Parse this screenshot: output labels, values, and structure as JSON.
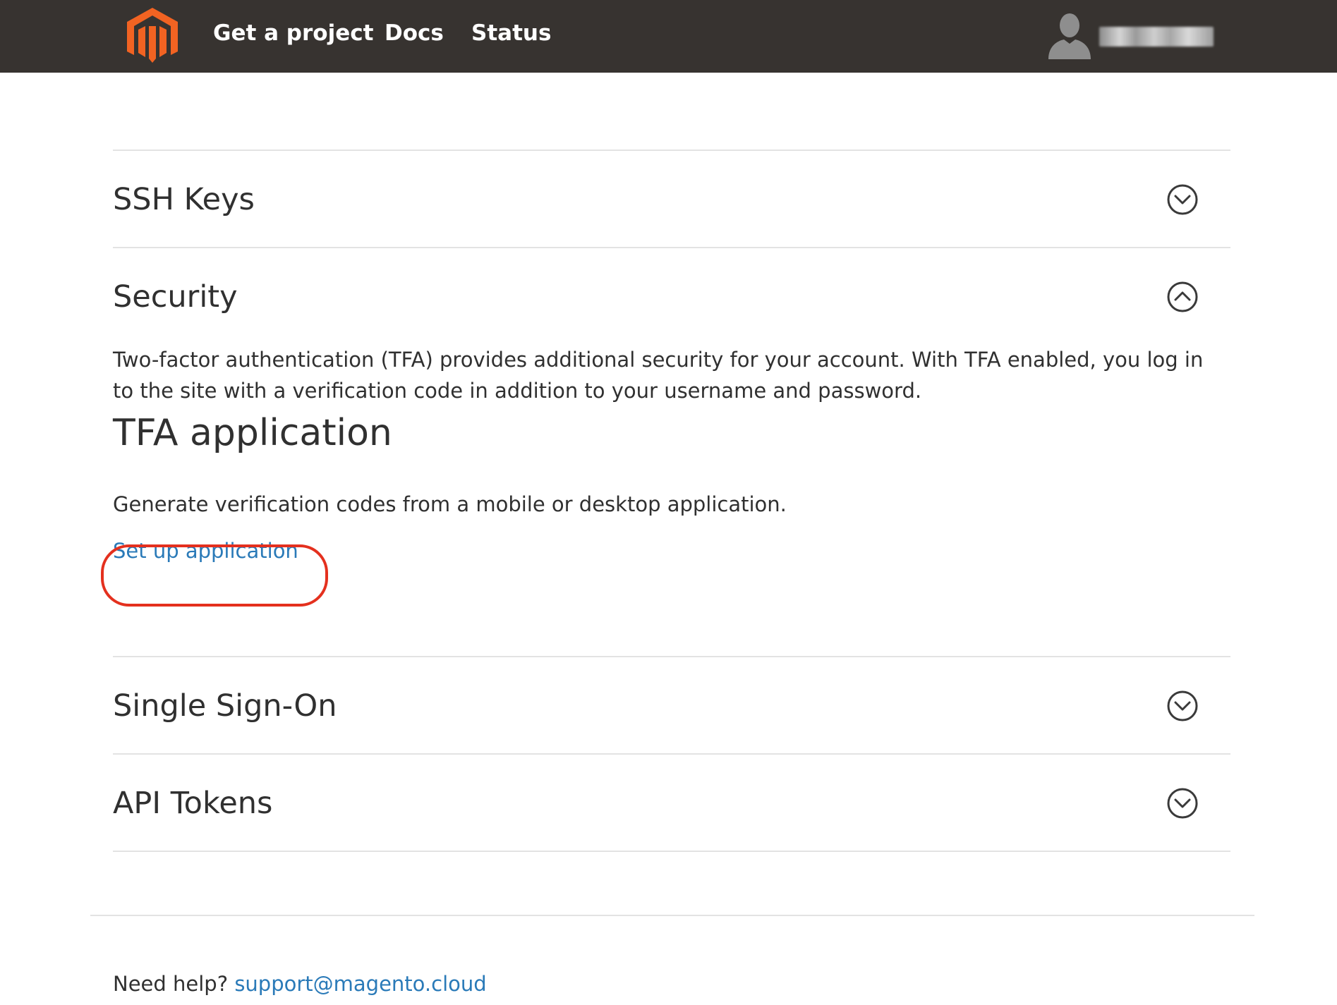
{
  "nav": {
    "items": [
      {
        "label": "Get a project"
      },
      {
        "label": "Docs"
      },
      {
        "label": "Status"
      }
    ]
  },
  "user": {
    "name": "",
    "avatar_icon": "user-silhouette-icon"
  },
  "sections": [
    {
      "title": "SSH Keys",
      "expanded": false,
      "icon": "chevron-down-circle-icon"
    },
    {
      "title": "Security",
      "expanded": true,
      "icon": "chevron-up-circle-icon"
    },
    {
      "title": "Single Sign-On",
      "expanded": false,
      "icon": "chevron-down-circle-icon"
    },
    {
      "title": "API Tokens",
      "expanded": false,
      "icon": "chevron-down-circle-icon"
    }
  ],
  "security": {
    "description": "Two-factor authentication (TFA) provides additional security for your account. With TFA enabled, you log in to the site with a verification code in addition to your username and password.",
    "tfa_title": "TFA application",
    "tfa_description": "Generate verification codes from a mobile or desktop application.",
    "setup_link": "Set up application"
  },
  "footer": {
    "help_label": "Need help?",
    "support_email": "support@magento.cloud"
  },
  "colors": {
    "topbar": "#373330",
    "brand_orange": "#f26322",
    "link": "#2a7ab8",
    "highlight": "#e4301e",
    "divider": "#e3e3e3"
  }
}
